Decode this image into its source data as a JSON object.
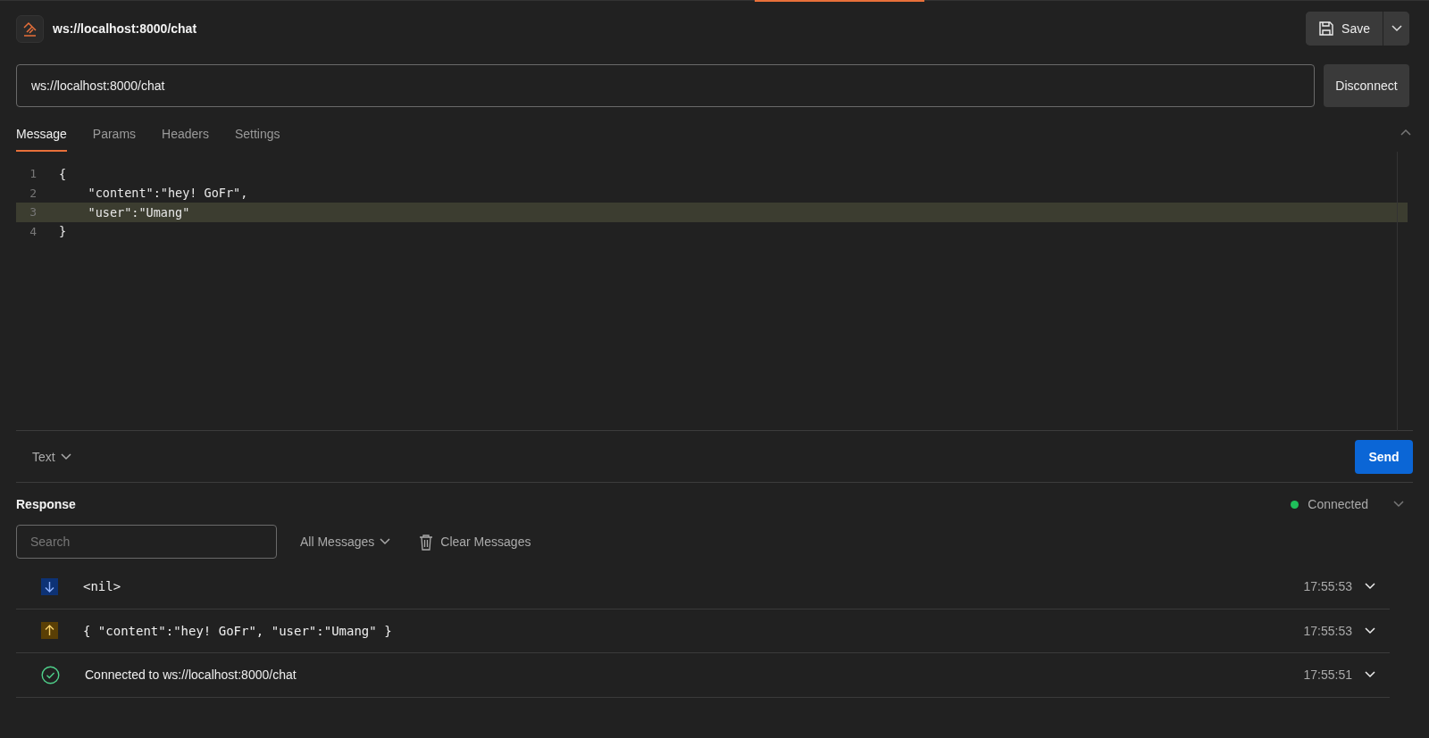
{
  "header": {
    "title": "ws://localhost:8000/chat",
    "save_label": "Save"
  },
  "url_bar": {
    "value": "ws://localhost:8000/chat",
    "button": "Disconnect"
  },
  "tabs": [
    {
      "label": "Message",
      "selected": true
    },
    {
      "label": "Params",
      "selected": false
    },
    {
      "label": "Headers",
      "selected": false
    },
    {
      "label": "Settings",
      "selected": false
    }
  ],
  "editor": {
    "lines": [
      {
        "number": "1",
        "text": "{",
        "current": false
      },
      {
        "number": "2",
        "text": "    \"content\":\"hey! GoFr\",",
        "current": false
      },
      {
        "number": "3",
        "text": "    \"user\":\"Umang\"",
        "current": true
      },
      {
        "number": "4",
        "text": "}",
        "current": false
      }
    ]
  },
  "composer": {
    "format": "Text",
    "send": "Send"
  },
  "response": {
    "title": "Response",
    "status": "Connected",
    "connected": true,
    "search": {
      "placeholder": "Search"
    },
    "filter": "All Messages",
    "clear": "Clear Messages",
    "messages": [
      {
        "kind": "incoming",
        "text": "<nil>",
        "time": "17:55:53"
      },
      {
        "kind": "outgoing",
        "text": "{ \"content\":\"hey! GoFr\", \"user\":\"Umang\" }",
        "time": "17:55:53"
      },
      {
        "kind": "status",
        "text": "Connected to ws://localhost:8000/chat",
        "time": "17:55:51"
      }
    ]
  }
}
